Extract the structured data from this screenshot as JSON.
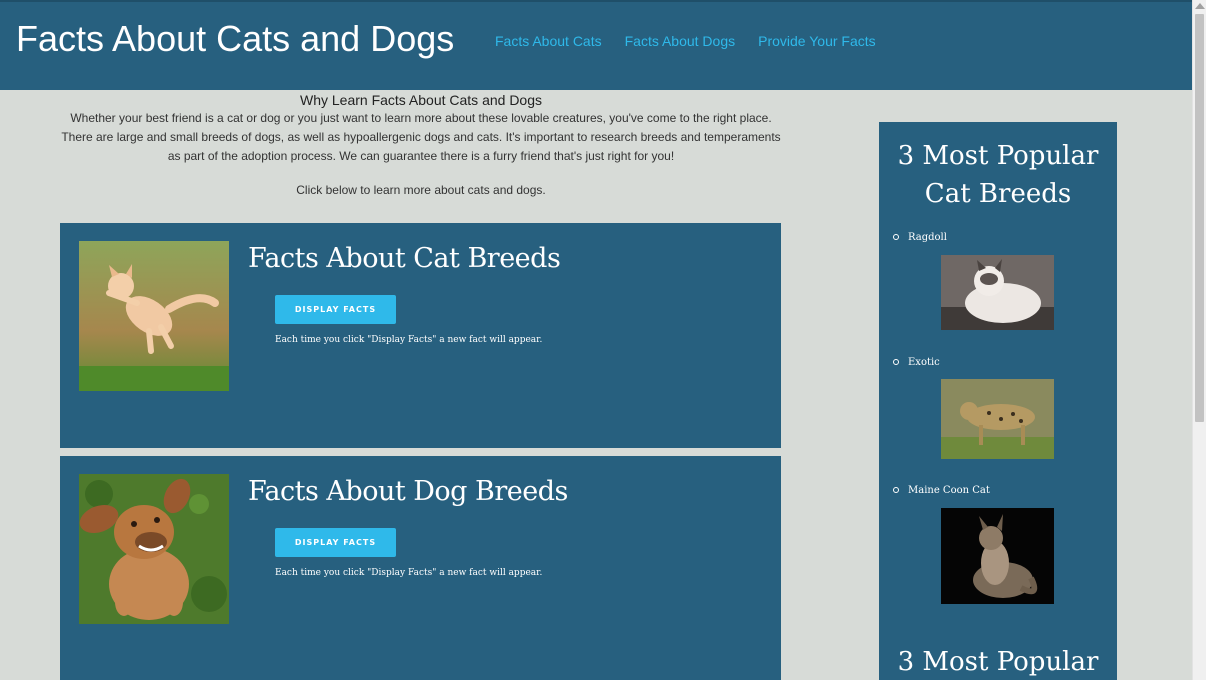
{
  "header": {
    "title": "Facts About Cats and Dogs",
    "nav": [
      "Facts About Cats",
      "Facts About Dogs",
      "Provide Your Facts"
    ]
  },
  "intro": {
    "title": "Why Learn Facts About Cats and Dogs",
    "paragraph": "Whether your best friend is a cat or dog or you just want to learn more about these lovable creatures, you've come to the right place. There are large and small breeds of dogs, as well as hypoallergenic dogs and cats. It's important to research breeds and temperaments as part of the adoption process. We can guarantee there is a furry friend that's just right for you!",
    "cta": "Click below to learn more about cats and dogs."
  },
  "cards": [
    {
      "title": "Facts About Cat Breeds",
      "button": "DISPLAY FACTS",
      "note": "Each time you click \"Display Facts\" a new fact will appear."
    },
    {
      "title": "Facts About Dog Breeds",
      "button": "DISPLAY FACTS",
      "note": "Each time you click \"Display Facts\" a new fact will appear."
    }
  ],
  "sidebar": {
    "title": "3 Most Popular Cat Breeds",
    "breeds": [
      "Ragdoll",
      "Exotic",
      "Maine Coon Cat"
    ],
    "next_title": "3 Most Popular"
  }
}
